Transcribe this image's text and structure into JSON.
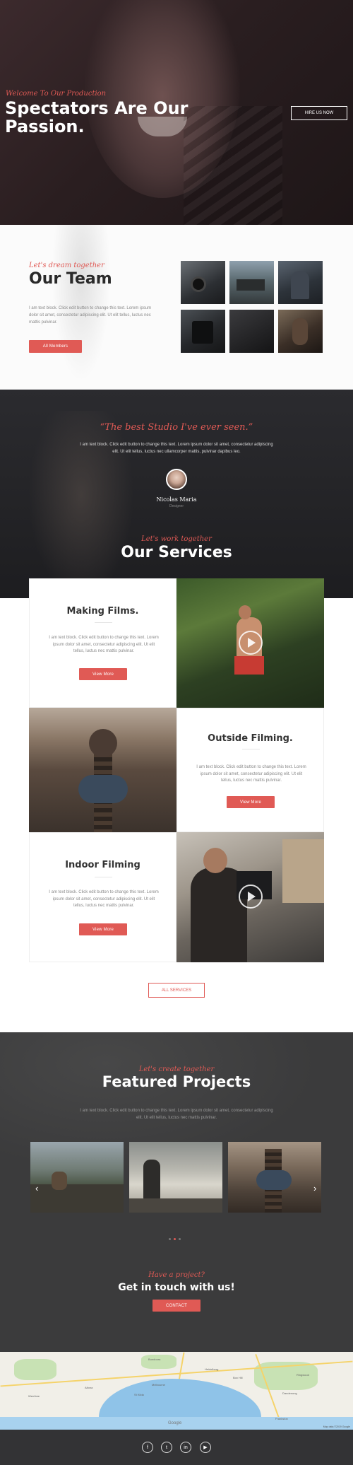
{
  "hero": {
    "pre_title": "Welcome To Our Production",
    "title": "Spectators Are Our Passion.",
    "cta": "HIRE US NOW"
  },
  "team": {
    "pre_title": "Let's dream together",
    "title": "Our Team",
    "text": "I am text block. Click edit button to change this text. Lorem ipsum dolor sit amet, consectetur adipiscing elit. Ut elit tellus, luctus nec mattis pulvinar.",
    "button": "All Members"
  },
  "testimonial": {
    "quote": "“The best Studio I've ever seen.”",
    "text": "I am text block. Click edit button to change this text. Lorem ipsum dolor sit amet, consectetur adipiscing elit. Ut elit tellus, luctus nec ullamcorper mattis, pulvinar dapibus leo.",
    "name": "Nicolas Maria",
    "role": "Designer"
  },
  "services": {
    "pre_title": "Let's work together",
    "title": "Our Services",
    "items": [
      {
        "title": "Making Films.",
        "text": "I am text block. Click edit button to change this text. Lorem ipsum dolor sit amet, consectetur adipiscing elit. Ut elit tellus, luctus nec mattis pulvinar.",
        "button": "View More"
      },
      {
        "title": "Outside Filming.",
        "text": "I am text block. Click edit button to change this text. Lorem ipsum dolor sit amet, consectetur adipiscing elit. Ut elit tellus, luctus nec mattis pulvinar.",
        "button": "View More"
      },
      {
        "title": "Indoor Filming",
        "text": "I am text block. Click edit button to change this text. Lorem ipsum dolor sit amet, consectetur adipiscing elit. Ut elit tellus, luctus nec mattis pulvinar.",
        "button": "View More"
      }
    ],
    "all_button": "ALL SERVICES"
  },
  "projects": {
    "pre_title": "Let's create together",
    "title": "Featured Projects",
    "text": "I am text block. Click edit button to change this text. Lorem ipsum dolor sit amet, consectetur adipiscing elit. Ut elit tellus, luctus nec mattis pulvinar.",
    "prev_icon": "chevron-left-icon",
    "next_icon": "chevron-right-icon"
  },
  "contact": {
    "pre_title": "Have a project?",
    "title": "Get in touch with us!",
    "button": "CONTACT"
  },
  "map": {
    "brand": "Google",
    "credit": "Map data ©2019 Google",
    "labels": [
      "Bundoora",
      "Heidelberg",
      "Ringwood",
      "Box Hill",
      "Melbourne",
      "St Kilda",
      "Frankston",
      "Dandenong",
      "Werribee",
      "Altona"
    ]
  },
  "footer": {
    "social": [
      {
        "icon": "facebook-icon",
        "glyph": "f"
      },
      {
        "icon": "twitter-icon",
        "glyph": "t"
      },
      {
        "icon": "linkedin-icon",
        "glyph": "in"
      },
      {
        "icon": "youtube-icon",
        "glyph": "▶"
      }
    ]
  },
  "colors": {
    "accent": "#e05a55",
    "dark": "#333335",
    "projects_bg": "#3b3b3c"
  }
}
